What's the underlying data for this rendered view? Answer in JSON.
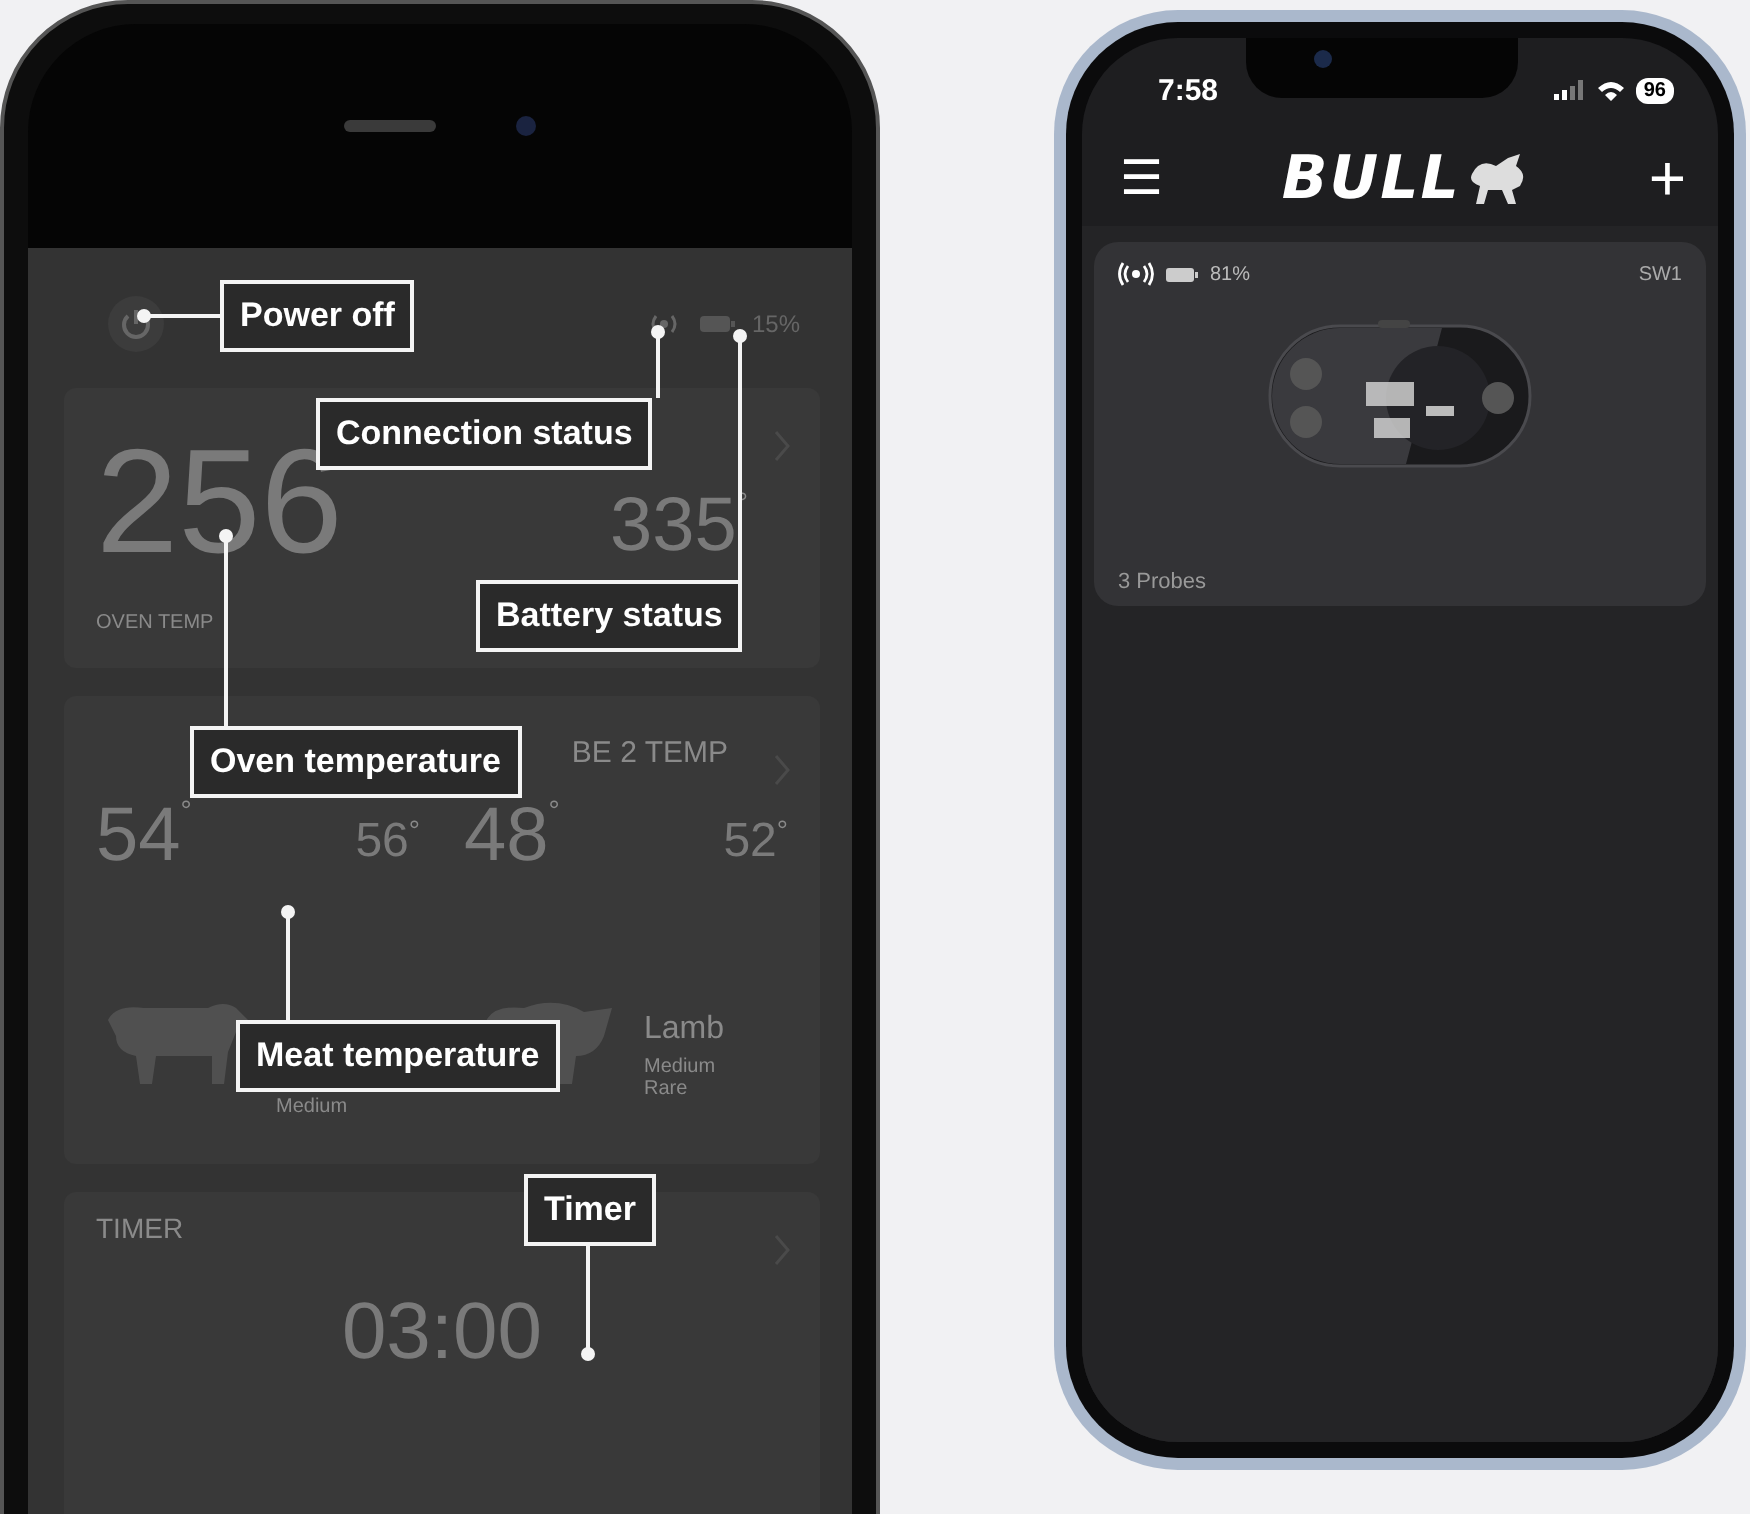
{
  "left_phone": {
    "header": {
      "battery": "15%"
    },
    "oven_card": {
      "current": "256",
      "target": "335",
      "degree": "°",
      "label": "OVEN TEMP"
    },
    "probe_card": {
      "header": "BE 2 TEMP",
      "probes": [
        {
          "current": "54",
          "target": "56",
          "doneness": "Medium"
        },
        {
          "current": "48",
          "target": "52",
          "meat": "Lamb",
          "doneness": "Medium Rare"
        }
      ]
    },
    "timer_card": {
      "title": "TIMER",
      "time": "03:00"
    },
    "annotations": [
      "Power off",
      "Connection status",
      "Battery status",
      "Oven temperature",
      "Meat temperature",
      "Timer"
    ]
  },
  "right_phone": {
    "status_bar": {
      "time": "7:58",
      "battery": "96"
    },
    "nav": {
      "menu": "☰",
      "logo": "BULL",
      "add": "+"
    },
    "device_card": {
      "battery": "81%",
      "name": "SW1",
      "probes": "3 Probes"
    }
  }
}
